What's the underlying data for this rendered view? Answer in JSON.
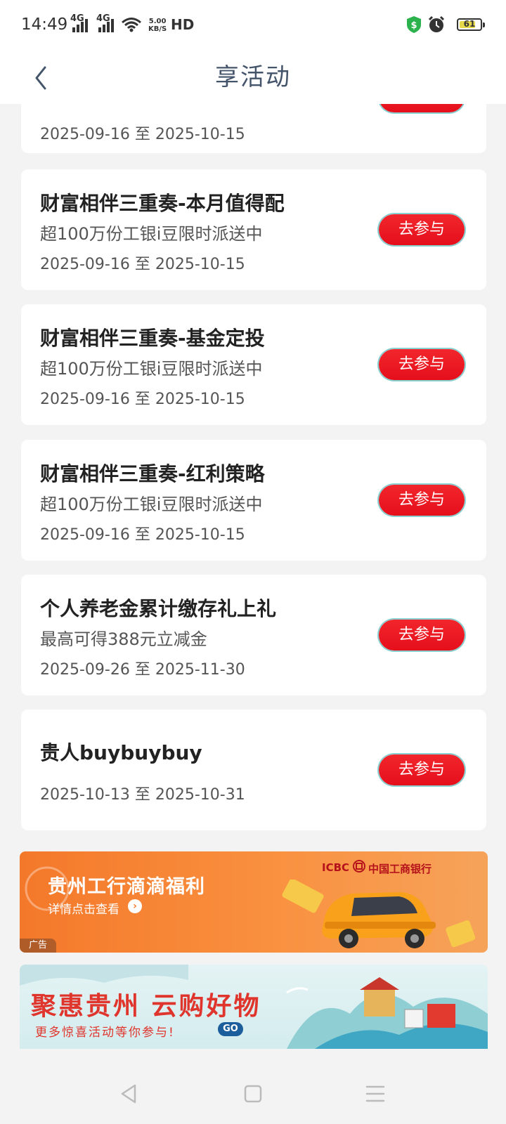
{
  "status_bar": {
    "time": "14:49",
    "signal1": "4G",
    "signal2": "4G",
    "net_speed_value": "5.00",
    "net_speed_unit": "KB/S",
    "hd": "HD",
    "battery": "61",
    "icons": [
      "shield-dollar-icon",
      "alarm-icon",
      "battery-icon",
      "wifi-icon"
    ]
  },
  "header": {
    "title": "享活动"
  },
  "cards": [
    {
      "title": "",
      "subtitle": "",
      "date": "2025-09-16 至 2025-10-15"
    },
    {
      "title": "财富相伴三重奏-本月值得配",
      "subtitle": "超100万份工银i豆限时派送中",
      "date": "2025-09-16 至 2025-10-15",
      "button": "去参与"
    },
    {
      "title": "财富相伴三重奏-基金定投",
      "subtitle": "超100万份工银i豆限时派送中",
      "date": "2025-09-16 至 2025-10-15",
      "button": "去参与"
    },
    {
      "title": "财富相伴三重奏-红利策略",
      "subtitle": "超100万份工银i豆限时派送中",
      "date": "2025-09-16 至 2025-10-15",
      "button": "去参与"
    },
    {
      "title": "个人养老金累计缴存礼上礼",
      "subtitle": "最高可得388元立减金",
      "date": "2025-09-26 至 2025-11-30",
      "button": "去参与"
    },
    {
      "title": "贵人buybuybuy",
      "date": "2025-10-13 至 2025-10-31",
      "button": "去参与"
    }
  ],
  "banner1": {
    "title": "贵州工行滴滴福利",
    "subtitle": "详情点击查看",
    "logo_en": "ICBC",
    "logo_cn": "中国工商银行",
    "ad_label": "广告"
  },
  "banner2": {
    "title": "聚惠贵州 云购好物",
    "subtitle": "更多惊喜活动等你参与!",
    "go": "GO"
  },
  "colors": {
    "accent_red": "#e81822",
    "title_color": "#44546a",
    "background": "#f3f3f3"
  }
}
